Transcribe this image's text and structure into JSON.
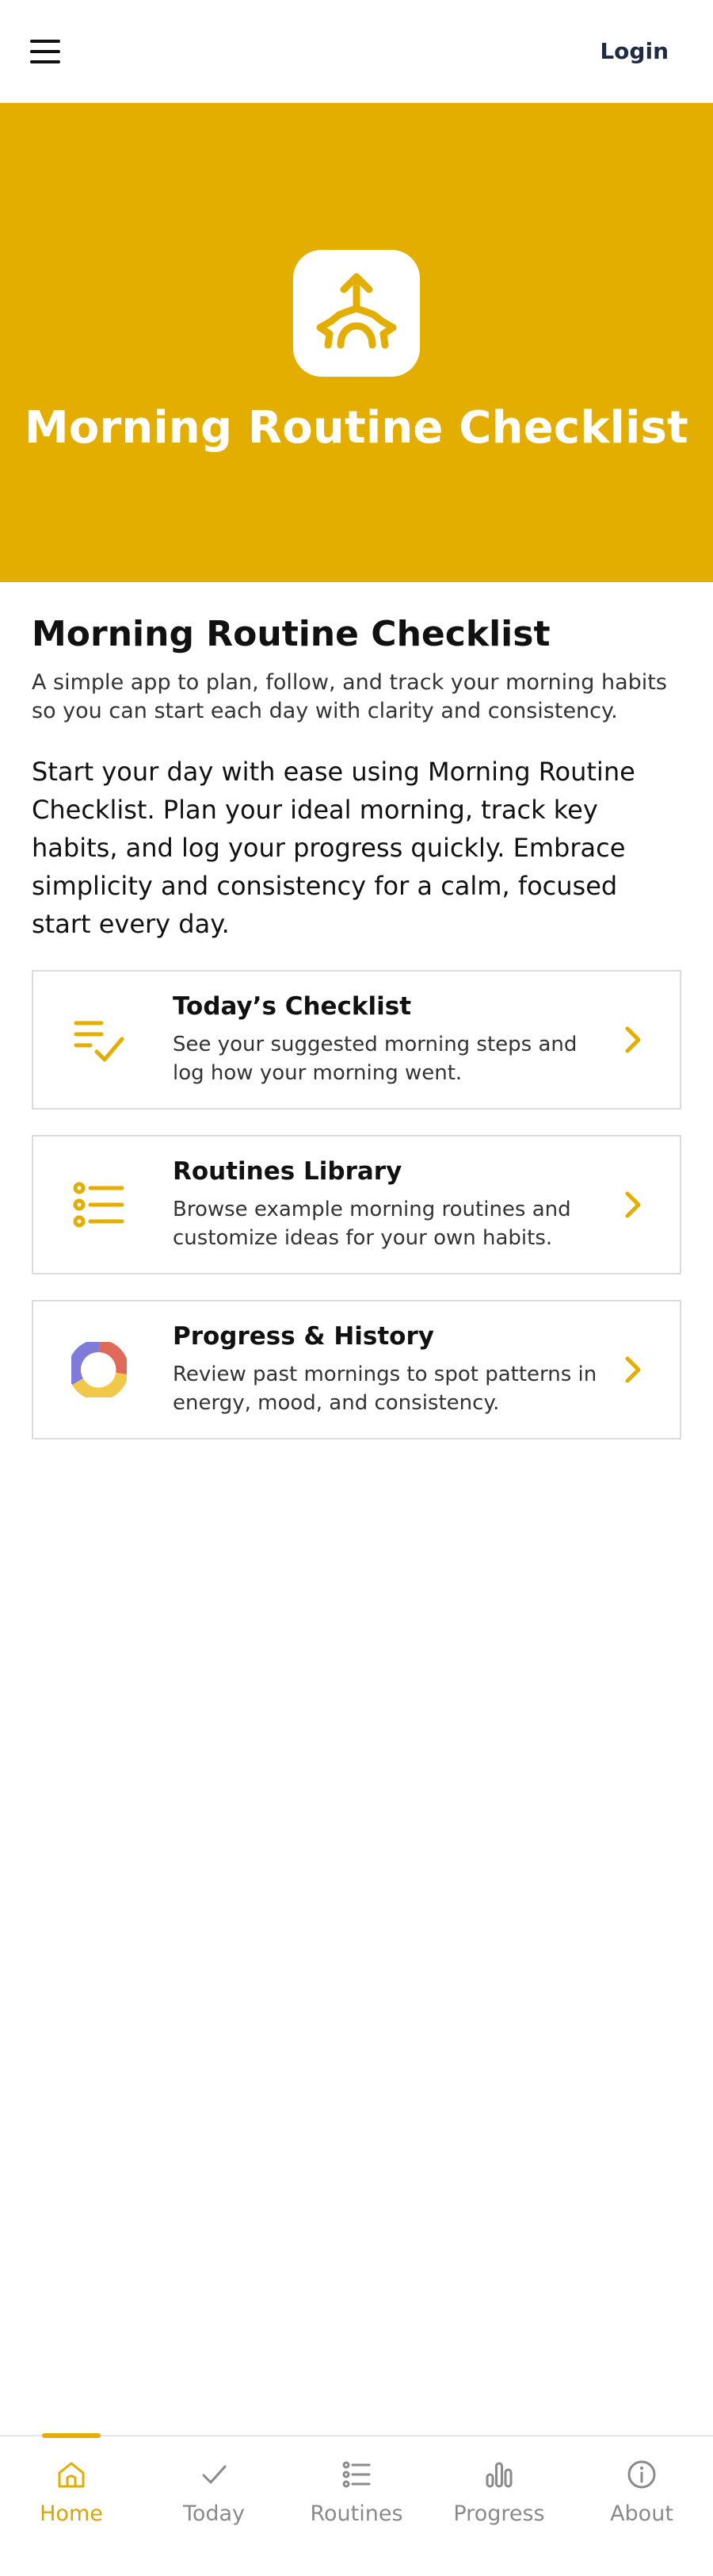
{
  "header": {
    "menu_icon": "hamburger-menu-icon",
    "login_label": "Login"
  },
  "hero": {
    "icon": "sunrise-arrow-icon",
    "title": "Morning Routine Checklist",
    "background": "#e3ae00"
  },
  "main": {
    "title": "Morning Routine Checklist",
    "subtitle": "A simple app to plan, follow, and track your morning habits so you can start each day with clarity and consistency.",
    "intro": "Start your day with ease using Morning Routine Checklist. Plan your ideal morning, track key habits, and log your progress quickly. Embrace simplicity and consistency for a calm, focused start every day."
  },
  "cards": [
    {
      "title": "Today’s Checklist",
      "description": "See your suggested morning steps and log how your morning went.",
      "icon": "checklist-icon"
    },
    {
      "title": "Routines Library",
      "description": "Browse example morning routines and customize ideas for your own habits.",
      "icon": "list-icon"
    },
    {
      "title": "Progress & History",
      "description": "Review past mornings to spot patterns in energy, mood, and consistency.",
      "icon": "donut-chart-icon"
    }
  ],
  "bottom_nav": [
    {
      "label": "Home",
      "icon": "home-icon",
      "active": true
    },
    {
      "label": "Today",
      "icon": "check-icon",
      "active": false
    },
    {
      "label": "Routines",
      "icon": "list-icon",
      "active": false
    },
    {
      "label": "Progress",
      "icon": "bar-chart-icon",
      "active": false
    },
    {
      "label": "About",
      "icon": "info-icon",
      "active": false
    }
  ],
  "colors": {
    "accent": "#e3ae00",
    "nav_active": "#d9a300",
    "nav_inactive": "#8a8a8a",
    "login": "#1f2a44"
  }
}
